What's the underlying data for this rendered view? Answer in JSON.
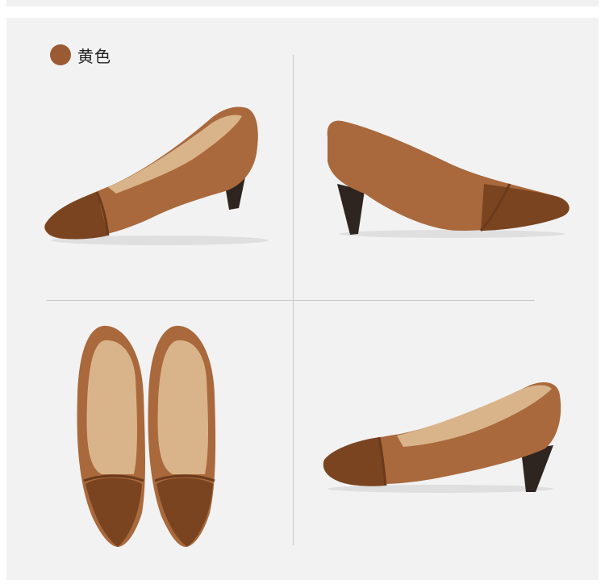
{
  "color_option": {
    "label": "黄色",
    "swatch_hex": "#9a5a34"
  },
  "palette": {
    "leather": "#a9693c",
    "leather_dark": "#7a4421",
    "lining": "#d9b48a",
    "heel": "#2e2420",
    "panel_bg": "#f2f2f2"
  },
  "views": [
    {
      "id": "front-three-quarter",
      "icon": "shoe-photo"
    },
    {
      "id": "side-profile",
      "icon": "shoe-photo"
    },
    {
      "id": "top-pair",
      "icon": "shoe-photo"
    },
    {
      "id": "side-low",
      "icon": "shoe-photo"
    }
  ]
}
